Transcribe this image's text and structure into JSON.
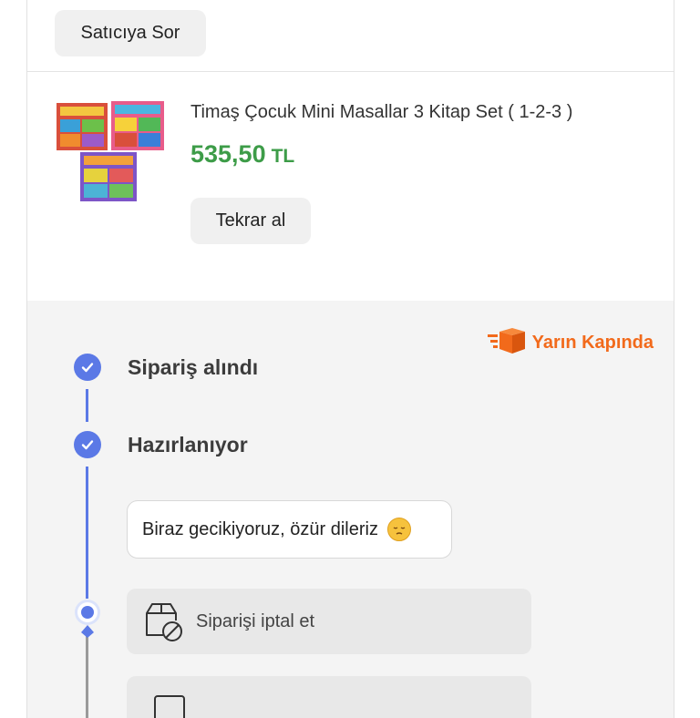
{
  "header": {
    "ask_seller_label": "Satıcıya Sor"
  },
  "product": {
    "title": "Timaş Çocuk Mini Masallar 3 Kitap Set ( 1-2-3 )",
    "price": "535,50",
    "currency": "TL",
    "buy_again_label": "Tekrar al",
    "thumbnail_icon": "book-set-image"
  },
  "tracking": {
    "delivery_badge": "Yarın Kapında",
    "delivery_icon": "box-icon",
    "steps": [
      {
        "label": "Sipariş alındı",
        "status": "done"
      },
      {
        "label": "Hazırlanıyor",
        "status": "done"
      }
    ],
    "delay_message": "Biraz gecikiyoruz, özür dileriz",
    "delay_emoji": "pensive-face",
    "actions": [
      {
        "label": "Siparişi iptal et",
        "icon": "cancel-package-icon"
      },
      {
        "label": "",
        "icon": "document-icon"
      }
    ]
  },
  "colors": {
    "accent_blue": "#5b79e6",
    "price_green": "#3d9c48",
    "delivery_orange": "#f26a1b"
  }
}
